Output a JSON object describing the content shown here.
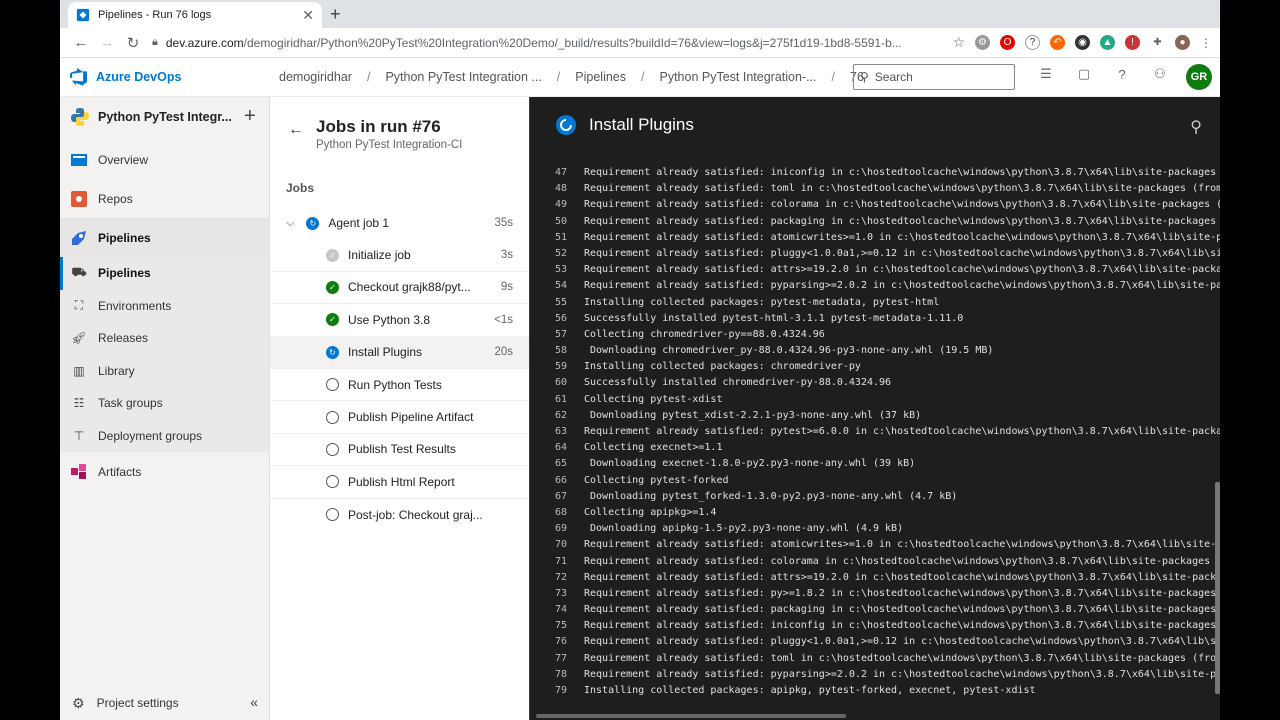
{
  "browser": {
    "tab_title": "Pipelines - Run 76 logs",
    "new_tab": "+",
    "url_domain": "dev.azure.com",
    "url_rest": "/demogiridhar/Python%20PyTest%20Integration%20Demo/_build/results?buildId=76&view=logs&j=275f1d19-1bd8-5591-b..."
  },
  "header": {
    "brand": "Azure DevOps",
    "breadcrumbs": [
      "demogiridhar",
      "Python PyTest Integration ...",
      "Pipelines",
      "Python PyTest Integration-...",
      "76"
    ],
    "search_placeholder": "Search",
    "avatar_initials": "GR"
  },
  "leftnav": {
    "project": "Python PyTest Integr...",
    "items": [
      {
        "label": "Overview"
      },
      {
        "label": "Repos"
      },
      {
        "label": "Pipelines"
      },
      {
        "label": "Pipelines"
      },
      {
        "label": "Environments"
      },
      {
        "label": "Releases"
      },
      {
        "label": "Library"
      },
      {
        "label": "Task groups"
      },
      {
        "label": "Deployment groups"
      },
      {
        "label": "Artifacts"
      }
    ],
    "settings": "Project settings"
  },
  "jobs": {
    "title": "Jobs in run #76",
    "subtitle": "Python PyTest Integration-CI",
    "section": "Jobs",
    "agent": {
      "label": "Agent job 1",
      "duration": "35s"
    },
    "steps": [
      {
        "label": "Initialize job",
        "duration": "3s",
        "status": "skipped"
      },
      {
        "label": "Checkout grajk88/pyt...",
        "duration": "9s",
        "status": "success"
      },
      {
        "label": "Use Python 3.8",
        "duration": "<1s",
        "status": "success"
      },
      {
        "label": "Install Plugins",
        "duration": "20s",
        "status": "running"
      },
      {
        "label": "Run Python Tests",
        "duration": "",
        "status": "pending"
      },
      {
        "label": "Publish Pipeline Artifact",
        "duration": "",
        "status": "pending"
      },
      {
        "label": "Publish Test Results",
        "duration": "",
        "status": "pending"
      },
      {
        "label": "Publish Html Report",
        "duration": "",
        "status": "pending"
      },
      {
        "label": "Post-job: Checkout graj...",
        "duration": "",
        "status": "pending"
      }
    ]
  },
  "log": {
    "title": "Install Plugins",
    "lines": [
      {
        "n": "47",
        "t": "Requirement already satisfied: iniconfig in c:\\hostedtoolcache\\windows\\python\\3.8.7\\x64\\lib\\site-packages (f"
      },
      {
        "n": "48",
        "t": "Requirement already satisfied: toml in c:\\hostedtoolcache\\windows\\python\\3.8.7\\x64\\lib\\site-packages (from p"
      },
      {
        "n": "49",
        "t": "Requirement already satisfied: colorama in c:\\hostedtoolcache\\windows\\python\\3.8.7\\x64\\lib\\site-packages (fr"
      },
      {
        "n": "50",
        "t": "Requirement already satisfied: packaging in c:\\hostedtoolcache\\windows\\python\\3.8.7\\x64\\lib\\site-packages (f"
      },
      {
        "n": "51",
        "t": "Requirement already satisfied: atomicwrites>=1.0 in c:\\hostedtoolcache\\windows\\python\\3.8.7\\x64\\lib\\site-pac"
      },
      {
        "n": "52",
        "t": "Requirement already satisfied: pluggy<1.0.0a1,>=0.12 in c:\\hostedtoolcache\\windows\\python\\3.8.7\\x64\\lib\\site"
      },
      {
        "n": "53",
        "t": "Requirement already satisfied: attrs>=19.2.0 in c:\\hostedtoolcache\\windows\\python\\3.8.7\\x64\\lib\\site-package"
      },
      {
        "n": "54",
        "t": "Requirement already satisfied: pyparsing>=2.0.2 in c:\\hostedtoolcache\\windows\\python\\3.8.7\\x64\\lib\\site-pack"
      },
      {
        "n": "55",
        "t": "Installing collected packages: pytest-metadata, pytest-html"
      },
      {
        "n": "56",
        "t": "Successfully installed pytest-html-3.1.1 pytest-metadata-1.11.0"
      },
      {
        "n": "57",
        "t": "Collecting chromedriver-py==88.0.4324.96"
      },
      {
        "n": "58",
        "t": "  Downloading chromedriver_py-88.0.4324.96-py3-none-any.whl (19.5 MB)"
      },
      {
        "n": "59",
        "t": "Installing collected packages: chromedriver-py"
      },
      {
        "n": "60",
        "t": "Successfully installed chromedriver-py-88.0.4324.96"
      },
      {
        "n": "61",
        "t": "Collecting pytest-xdist"
      },
      {
        "n": "62",
        "t": "  Downloading pytest_xdist-2.2.1-py3-none-any.whl (37 kB)"
      },
      {
        "n": "63",
        "t": "Requirement already satisfied: pytest>=6.0.0 in c:\\hostedtoolcache\\windows\\python\\3.8.7\\x64\\lib\\site-package"
      },
      {
        "n": "64",
        "t": "Collecting execnet>=1.1"
      },
      {
        "n": "65",
        "t": "  Downloading execnet-1.8.0-py2.py3-none-any.whl (39 kB)"
      },
      {
        "n": "66",
        "t": "Collecting pytest-forked"
      },
      {
        "n": "67",
        "t": "  Downloading pytest_forked-1.3.0-py2.py3-none-any.whl (4.7 kB)"
      },
      {
        "n": "68",
        "t": "Collecting apipkg>=1.4"
      },
      {
        "n": "69",
        "t": "  Downloading apipkg-1.5-py2.py3-none-any.whl (4.9 kB)"
      },
      {
        "n": "70",
        "t": "Requirement already satisfied: atomicwrites>=1.0 in c:\\hostedtoolcache\\windows\\python\\3.8.7\\x64\\lib\\site-pa"
      },
      {
        "n": "71",
        "t": "Requirement already satisfied: colorama in c:\\hostedtoolcache\\windows\\python\\3.8.7\\x64\\lib\\site-packages (f"
      },
      {
        "n": "72",
        "t": "Requirement already satisfied: attrs>=19.2.0 in c:\\hostedtoolcache\\windows\\python\\3.8.7\\x64\\lib\\site-package"
      },
      {
        "n": "73",
        "t": "Requirement already satisfied: py>=1.8.2 in c:\\hostedtoolcache\\windows\\python\\3.8.7\\x64\\lib\\site-packages (f"
      },
      {
        "n": "74",
        "t": "Requirement already satisfied: packaging in c:\\hostedtoolcache\\windows\\python\\3.8.7\\x64\\lib\\site-packages (f"
      },
      {
        "n": "75",
        "t": "Requirement already satisfied: iniconfig in c:\\hostedtoolcache\\windows\\python\\3.8.7\\x64\\lib\\site-packages (f"
      },
      {
        "n": "76",
        "t": "Requirement already satisfied: pluggy<1.0.0a1,>=0.12 in c:\\hostedtoolcache\\windows\\python\\3.8.7\\x64\\lib\\site"
      },
      {
        "n": "77",
        "t": "Requirement already satisfied: toml in c:\\hostedtoolcache\\windows\\python\\3.8.7\\x64\\lib\\site-packages (from p"
      },
      {
        "n": "78",
        "t": "Requirement already satisfied: pyparsing>=2.0.2 in c:\\hostedtoolcache\\windows\\python\\3.8.7\\x64\\lib\\site-pack"
      },
      {
        "n": "79",
        "t": "Installing collected packages: apipkg, pytest-forked, execnet, pytest-xdist"
      }
    ]
  },
  "colors": {
    "accent": "#0078d4",
    "success": "#107c10",
    "log_bg": "#1e1e1e"
  }
}
